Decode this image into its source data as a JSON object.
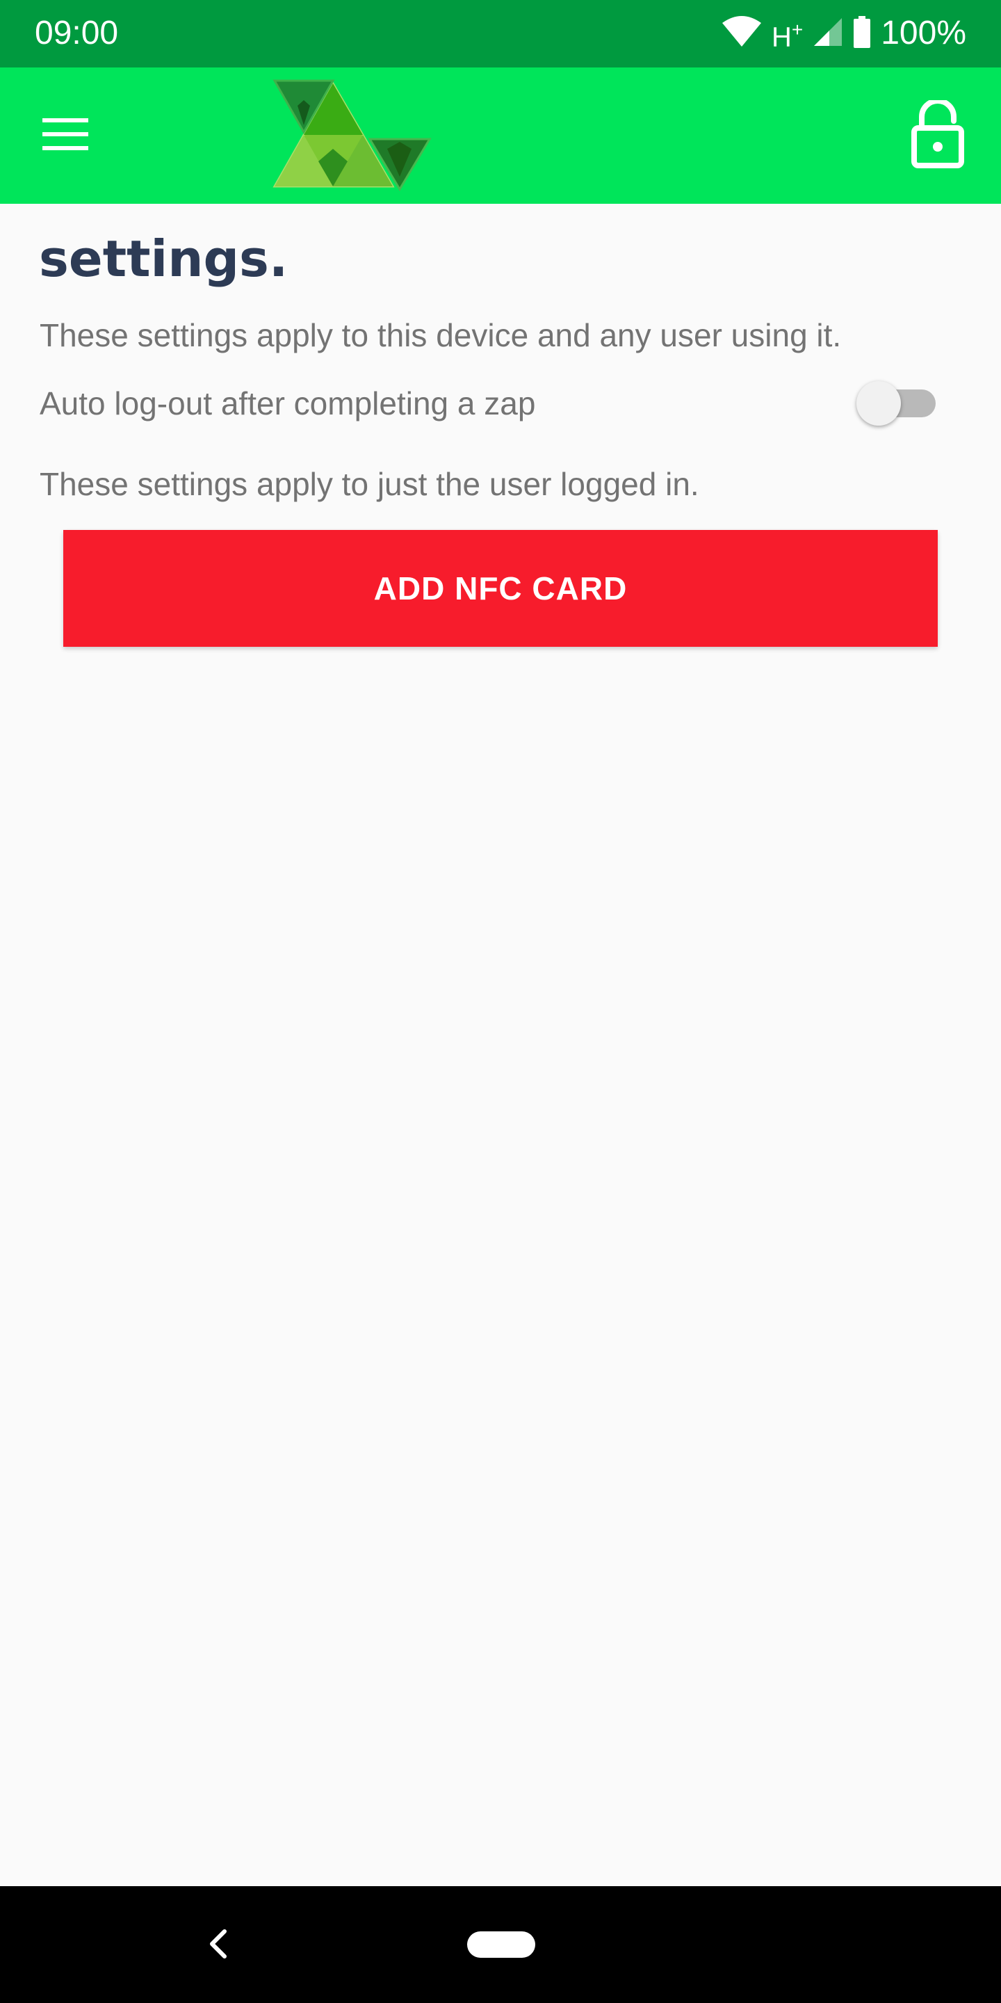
{
  "status_bar": {
    "time": "09:00",
    "network_label": "H",
    "network_suffix": "+",
    "battery_text": "100%",
    "icons": [
      "wifi-icon",
      "signal-icon",
      "battery-icon"
    ]
  },
  "app_bar": {
    "menu_icon": "hamburger-menu-icon",
    "logo_icon": "app-logo",
    "lock_icon": "unlocked-padlock-icon",
    "color": "#00e55a"
  },
  "settings": {
    "title": "settings.",
    "device_description": "These settings apply to this device and any user using it.",
    "auto_logout_label": "Auto log-out after completing a zap",
    "auto_logout_enabled": false,
    "user_description": "These settings apply to just the user logged in.",
    "add_nfc_label": "ADD NFC CARD"
  },
  "nav_bar": {
    "back_icon": "back-chevron-icon",
    "home_icon": "home-pill-icon"
  },
  "colors": {
    "status_bar": "#009a3f",
    "app_bar": "#00e55a",
    "title": "#2d3b55",
    "text": "#737373",
    "button": "#f71c2c",
    "background": "#fafafa"
  }
}
